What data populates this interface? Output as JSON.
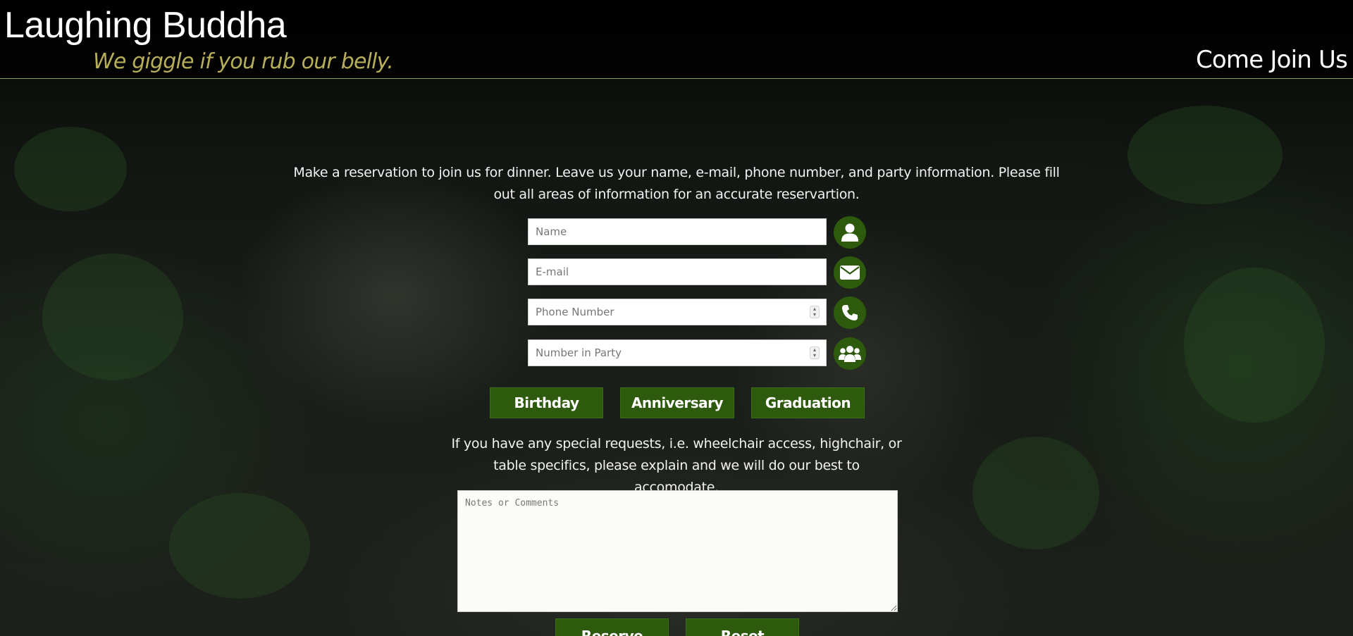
{
  "header": {
    "title": "Laughing Buddha",
    "tagline": "We giggle if you rub our belly.",
    "nav_link": "Come Join Us"
  },
  "reservation": {
    "intro": "Make a reservation to join us for dinner. Leave us your name, e-mail, phone number, and party information. Please fill out all areas of information for an accurate reservartion.",
    "fields": {
      "name": {
        "placeholder": "Name",
        "value": "",
        "icon": "user-icon"
      },
      "email": {
        "placeholder": "E-mail",
        "value": "",
        "icon": "envelope-icon"
      },
      "phone": {
        "placeholder": "Phone Number",
        "value": "",
        "icon": "phone-icon"
      },
      "party": {
        "placeholder": "Number in Party",
        "value": "",
        "icon": "group-icon"
      }
    },
    "occasions": [
      "Birthday",
      "Anniversary",
      "Graduation"
    ],
    "requests_text": "If you have any special requests, i.e. wheelchair access, highchair, or table specifics, please explain and we will do our best to accomodate.",
    "notes_placeholder": "Notes or Comments",
    "notes_value": "",
    "reserve_label": "Reserve",
    "reset_label": "Reset"
  },
  "colors": {
    "accent_green": "#2d5a0c",
    "tagline_gold": "#b7ae5a",
    "header_rule": "#8aa06a",
    "background": "#000000"
  }
}
